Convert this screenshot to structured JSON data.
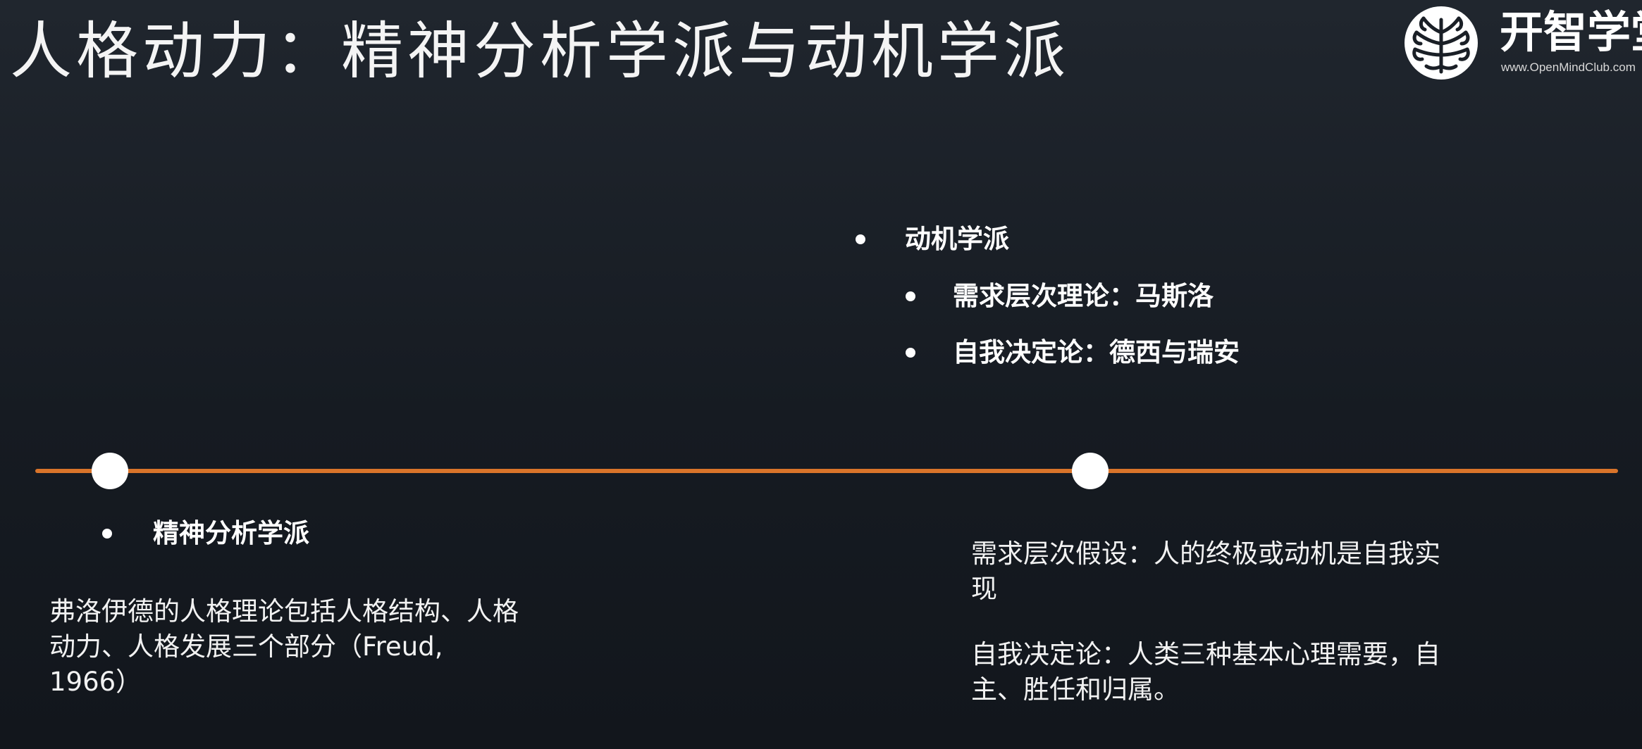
{
  "slide": {
    "title": "人格动力：精神分析学派与动机学派"
  },
  "logo": {
    "name": "开智学堂",
    "url": "www.OpenMindClub.com",
    "icon": "brain-tree-icon"
  },
  "timeline": {
    "line_color": "#d9742a",
    "dot_color": "#ffffff"
  },
  "motivation_school": {
    "heading": "动机学派",
    "items": [
      "需求层次理论：马斯洛",
      "自我决定论：德西与瑞安"
    ]
  },
  "psychoanalytic_school": {
    "heading": "精神分析学派",
    "description_lines": [
      "弗洛伊德的人格理论包括人格结构、人格",
      "动力、人格发展三个部分（Freud,",
      "1966）"
    ]
  },
  "right_notes": {
    "hierarchy_lines": [
      "需求层次假设：人的终极或动机是自我实",
      "现"
    ],
    "sdt_lines": [
      "自我决定论：人类三种基本心理需要，自",
      "主、胜任和归属。"
    ]
  },
  "colors": {
    "background": "#1a1f26",
    "text": "#ffffff",
    "accent": "#d9742a"
  }
}
